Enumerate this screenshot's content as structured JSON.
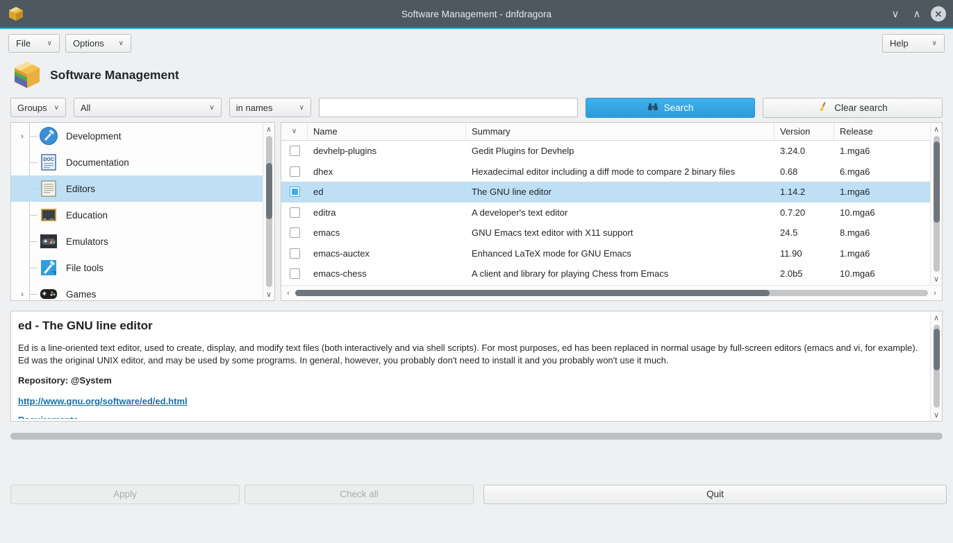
{
  "window": {
    "title": "Software Management - dnfdragora",
    "icon": "package-box-icon",
    "buttons": {
      "minimize": "∨",
      "maximize": "∧",
      "close": "✕"
    }
  },
  "menubar": {
    "file": "File",
    "options": "Options",
    "help": "Help",
    "caret": "∨"
  },
  "header": {
    "title": "Software Management"
  },
  "search": {
    "group_by": "Groups",
    "filter": "All",
    "scope": "in names",
    "query": "",
    "placeholder": "",
    "search_label": "Search",
    "search_icon": "binoculars-icon",
    "clear_label": "Clear search",
    "clear_icon": "broom-icon",
    "accent_color": "#2e9ada"
  },
  "tree": {
    "items": [
      {
        "label": "Development",
        "icon": "hammer-blue-icon",
        "expandable": true,
        "arrow": "›",
        "selected": false
      },
      {
        "label": "Documentation",
        "icon": "doc-icon",
        "expandable": false,
        "arrow": "",
        "selected": false
      },
      {
        "label": "Editors",
        "icon": "text-page-icon",
        "expandable": false,
        "arrow": "",
        "selected": true
      },
      {
        "label": "Education",
        "icon": "blackboard-icon",
        "expandable": false,
        "arrow": "",
        "selected": false
      },
      {
        "label": "Emulators",
        "icon": "gamepad-dark-icon",
        "expandable": false,
        "arrow": "",
        "selected": false
      },
      {
        "label": "File tools",
        "icon": "hammer-blue2-icon",
        "expandable": false,
        "arrow": "",
        "selected": false
      },
      {
        "label": "Games",
        "icon": "gamepad-black-icon",
        "expandable": true,
        "arrow": "›",
        "selected": false
      }
    ],
    "scrollbar": {
      "up": "∧",
      "down": "∨",
      "thumb_top_pct": 18,
      "thumb_height_pct": 37
    }
  },
  "table": {
    "columns": [
      "",
      "Name",
      "Summary",
      "Version",
      "Release"
    ],
    "header_sort_icon": "∨",
    "rows": [
      {
        "checked": false,
        "name": "devhelp-plugins",
        "summary": "Gedit Plugins for Devhelp",
        "version": "3.24.0",
        "release": "1.mga6",
        "selected": false
      },
      {
        "checked": false,
        "name": "dhex",
        "summary": "Hexadecimal editor including a diff mode to compare 2 binary files",
        "version": "0.68",
        "release": "6.mga6",
        "selected": false
      },
      {
        "checked": true,
        "name": "ed",
        "summary": "The GNU line editor",
        "version": "1.14.2",
        "release": "1.mga6",
        "selected": true
      },
      {
        "checked": false,
        "name": "editra",
        "summary": "A developer's text editor",
        "version": "0.7.20",
        "release": "10.mga6",
        "selected": false
      },
      {
        "checked": false,
        "name": "emacs",
        "summary": "GNU Emacs text editor with X11 support",
        "version": "24.5",
        "release": "8.mga6",
        "selected": false
      },
      {
        "checked": false,
        "name": "emacs-auctex",
        "summary": "Enhanced LaTeX mode for GNU Emacs",
        "version": "11.90",
        "release": "1.mga6",
        "selected": false
      },
      {
        "checked": false,
        "name": "emacs-chess",
        "summary": "A client and library for playing Chess from Emacs",
        "version": "2.0b5",
        "release": "10.mga6",
        "selected": false
      }
    ],
    "vscroll": {
      "up": "∧",
      "down": "∨",
      "thumb_top_pct": 4,
      "thumb_height_pct": 60
    },
    "hscroll": {
      "left": "‹",
      "right": "›",
      "thumb_left_pct": 0,
      "thumb_width_pct": 75
    }
  },
  "details": {
    "title": "ed - The GNU line editor",
    "description": "Ed is a line-oriented text editor, used to create, display, and modify text files (both interactively and via shell scripts). For most purposes, ed has been replaced in normal usage by full-screen editors (emacs and vi, for example). Ed was the original UNIX editor, and may be used by some programs. In general, however, you probably don't need to install it and you probably won't use it much.",
    "repository_label": "Repository: @System",
    "url": "http://www.gnu.org/software/ed/ed.html",
    "requirements_label": "Requirements",
    "vscroll": {
      "up": "∧",
      "down": "∨",
      "thumb_top_pct": 5,
      "thumb_height_pct": 50
    }
  },
  "actions": {
    "apply": "Apply",
    "check_all": "Check all",
    "quit": "Quit"
  }
}
